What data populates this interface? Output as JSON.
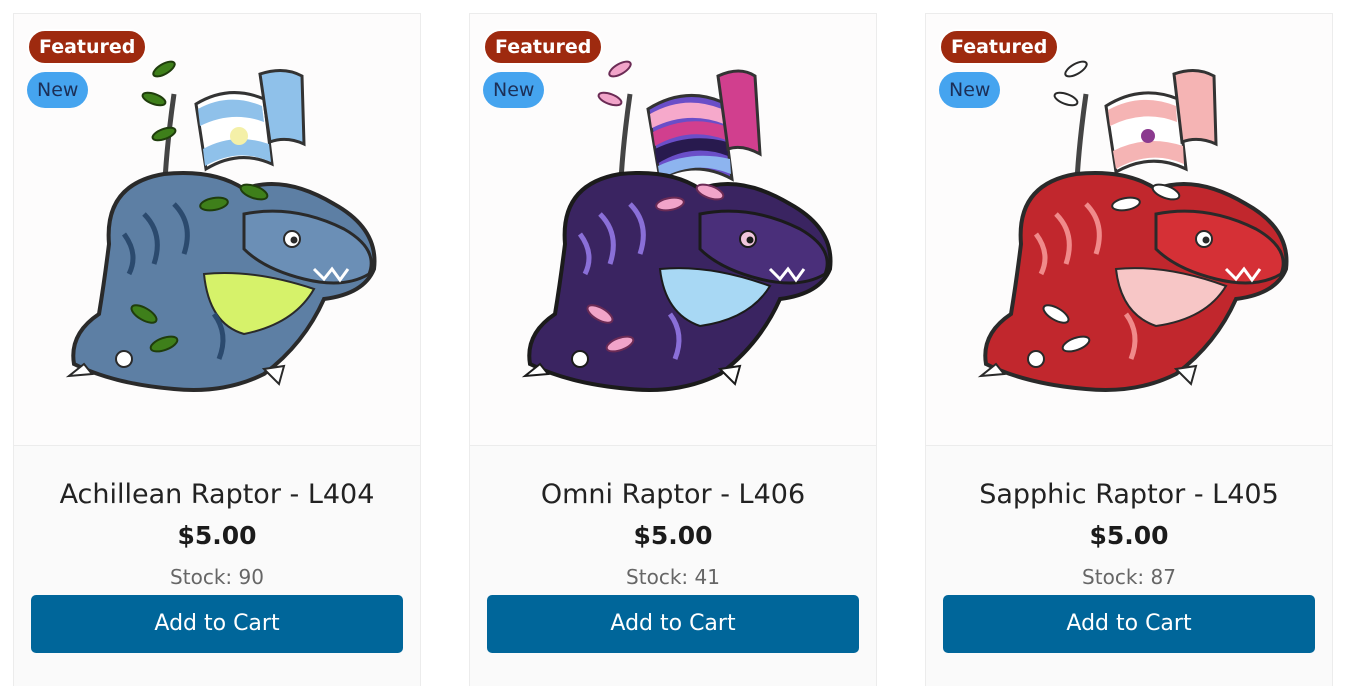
{
  "products": [
    {
      "title": "Achillean Raptor - L404",
      "price": "$5.00",
      "stock": "Stock: 90",
      "badges": {
        "featured": "Featured",
        "new": "New"
      },
      "button": "Add to Cart",
      "image": "achillean-raptor-pin",
      "colors": {
        "body": "#5d7fa4",
        "belly": "#d6f26a",
        "leaf": "#3e7f1a",
        "flag": [
          "#7fb7e6",
          "#ffffff"
        ]
      }
    },
    {
      "title": "Omni Raptor - L406",
      "price": "$5.00",
      "stock": "Stock: 41",
      "badges": {
        "featured": "Featured",
        "new": "New"
      },
      "button": "Add to Cart",
      "image": "omni-raptor-pin",
      "colors": {
        "body": "#3a2461",
        "belly": "#a8d8f4",
        "leaf": "#f1a4c9",
        "flag": [
          "#f6a9cb",
          "#d13f8e",
          "#281a4e",
          "#6a4ec8",
          "#8db4ef"
        ]
      }
    },
    {
      "title": "Sapphic Raptor - L405",
      "price": "$5.00",
      "stock": "Stock: 87",
      "badges": {
        "featured": "Featured",
        "new": "New"
      },
      "button": "Add to Cart",
      "image": "sapphic-raptor-pin",
      "colors": {
        "body": "#c1272d",
        "belly": "#f7c6c6",
        "leaf": "#ffffff",
        "flag": [
          "#f5b4b4",
          "#ffffff"
        ]
      }
    }
  ],
  "theme": {
    "button_bg": "#00669a",
    "featured_bg": "#9e2a0f",
    "new_bg": "#45a4ef"
  }
}
